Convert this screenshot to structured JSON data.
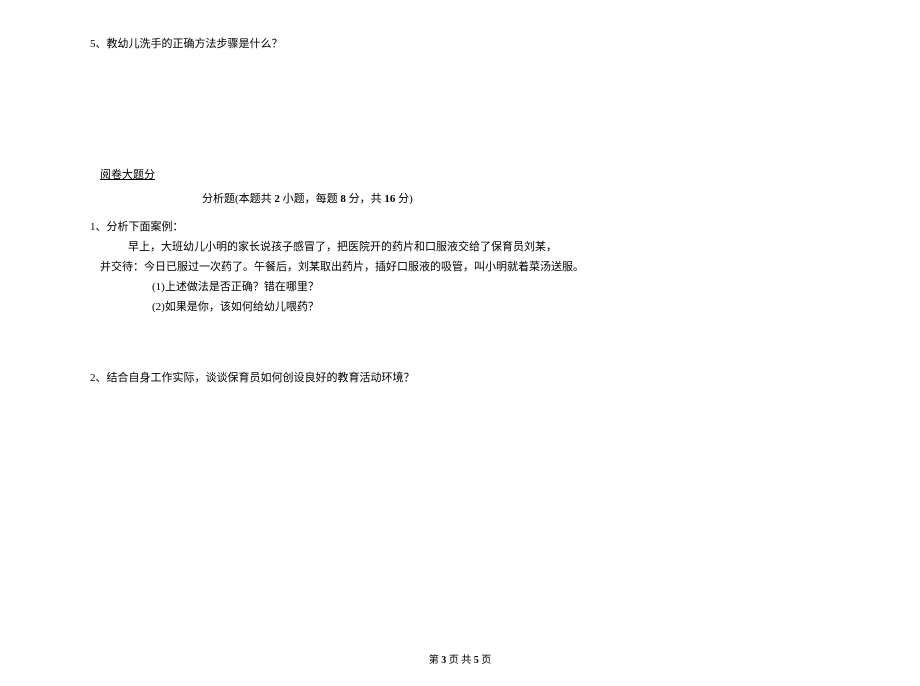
{
  "question5": "5、教幼儿洗手的正确方法步骤是什么？",
  "section": {
    "label": "阅卷大题分",
    "title_prefix": "分析题(本题共 ",
    "title_num1": "2",
    "title_mid1": " 小题，每题 ",
    "title_num2": "8",
    "title_mid2": " 分，共 ",
    "title_num3": "16",
    "title_suffix": " 分)"
  },
  "q1": {
    "line1": "1、分析下面案例：",
    "line2": "早上，大班幼儿小明的家长说孩子感冒了，把医院开的药片和口服液交给了保育员刘某，",
    "line3": "并交待：今日已服过一次药了。午餐后，刘某取出药片，插好口服液的吸管，叫小明就着菜汤送服。",
    "sub1": "(1)上述做法是否正确？错在哪里？",
    "sub2": "(2)如果是你，该如何给幼儿喂药？"
  },
  "q2": "2、结合自身工作实际，谈谈保育员如何创设良好的教育活动环境？",
  "footer": {
    "prefix": "第 ",
    "current": "3",
    "mid": " 页 共 ",
    "total": "5",
    "suffix": " 页"
  }
}
